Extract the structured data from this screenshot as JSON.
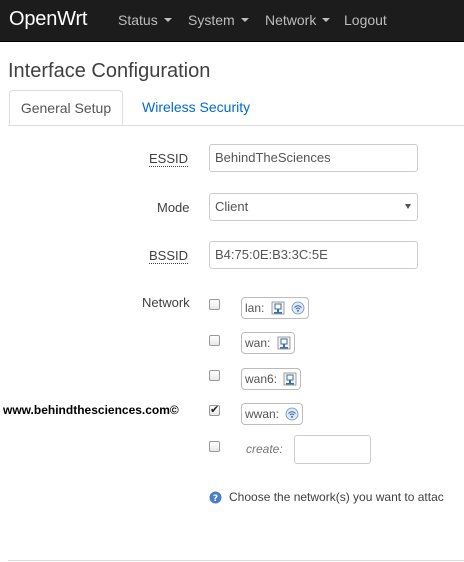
{
  "navbar": {
    "brand": "OpenWrt",
    "menu": [
      {
        "label": "Status",
        "has_caret": true
      },
      {
        "label": "System",
        "has_caret": true
      },
      {
        "label": "Network",
        "has_caret": true
      },
      {
        "label": "Logout",
        "has_caret": false
      }
    ]
  },
  "page": {
    "title": "Interface Configuration"
  },
  "tabs": [
    {
      "label": "General Setup",
      "active": true
    },
    {
      "label": "Wireless Security",
      "active": false
    }
  ],
  "form": {
    "essid": {
      "label": "ESSID",
      "value": "BehindTheSciences"
    },
    "mode": {
      "label": "Mode",
      "selected": "Client"
    },
    "bssid": {
      "label": "BSSID",
      "value": "B4:75:0E:B3:3C:5E"
    },
    "network": {
      "label": "Network",
      "options": [
        {
          "name": "lan:",
          "checked": false,
          "icons": [
            "ethernet-icon",
            "wifi-icon"
          ]
        },
        {
          "name": "wan:",
          "checked": false,
          "icons": [
            "ethernet-icon"
          ]
        },
        {
          "name": "wan6:",
          "checked": false,
          "icons": [
            "ethernet-icon"
          ]
        },
        {
          "name": "wwan:",
          "checked": true,
          "icons": [
            "wifi-icon"
          ]
        }
      ],
      "create_label": "create:",
      "create_value": "",
      "help": "Choose the network(s) you want to attac"
    }
  },
  "watermark": "www.behindthesciences.com©",
  "colors": {
    "navbar_bg": "#1c1c1c",
    "link": "#0069d6",
    "help_icon": "#4a7fc4"
  }
}
